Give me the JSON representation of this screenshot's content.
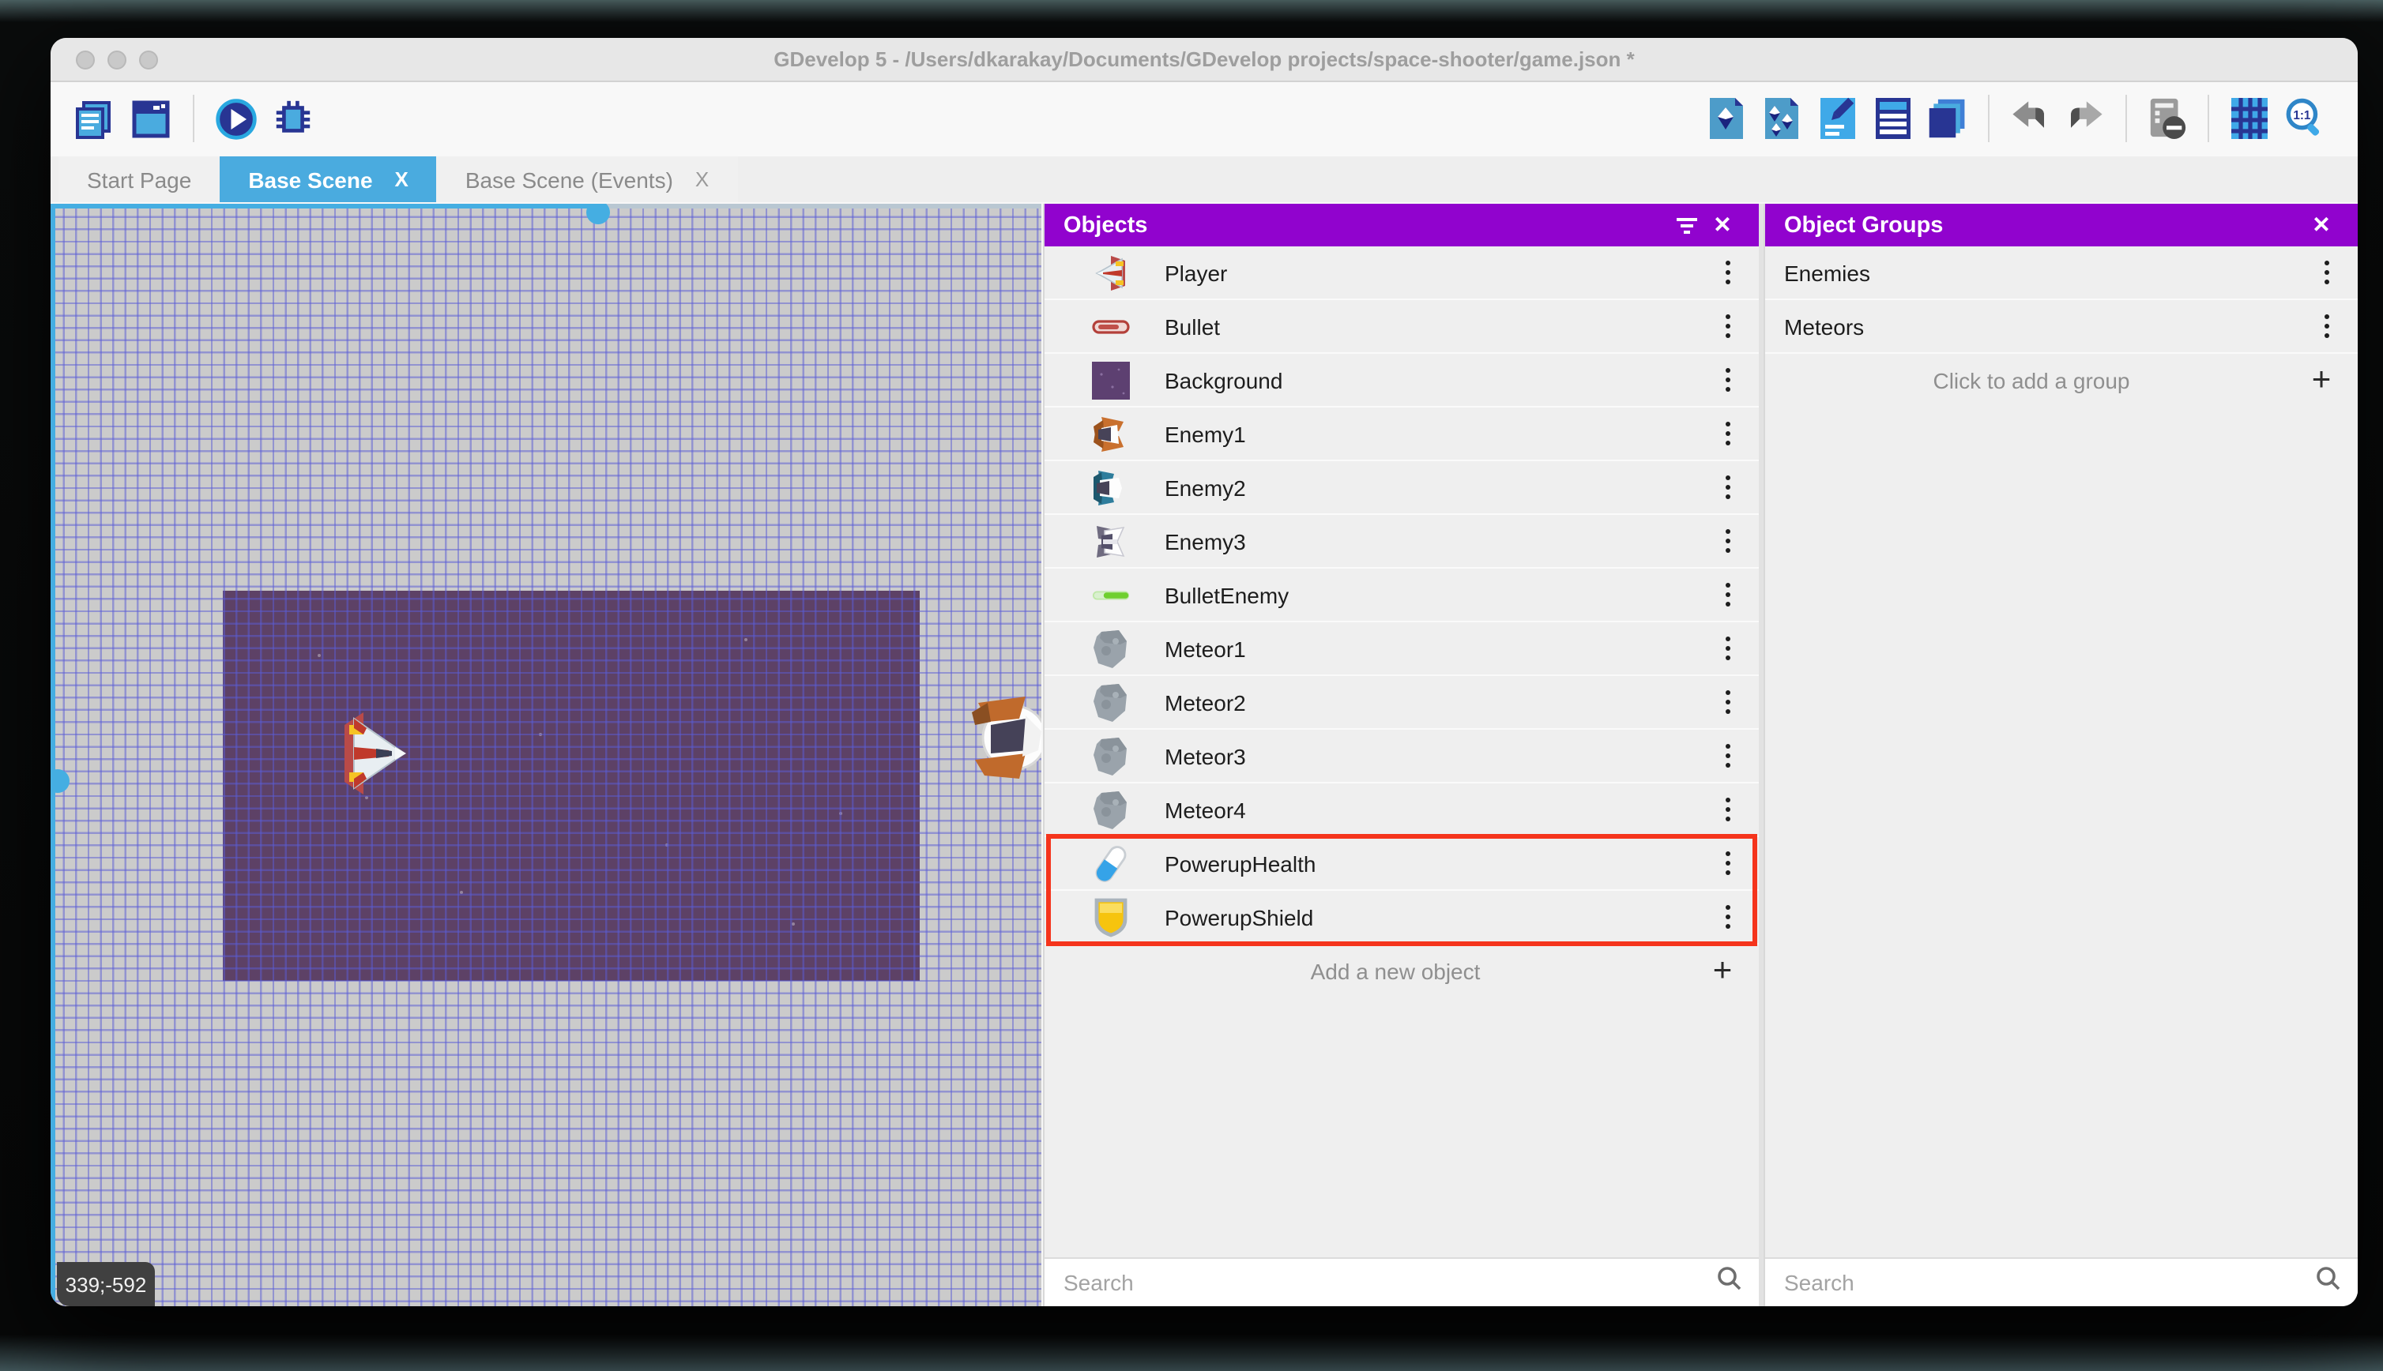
{
  "window": {
    "title": "GDevelop 5 - /Users/dkarakay/Documents/GDevelop projects/space-shooter/game.json *",
    "traffic_lights": [
      "close",
      "minimize",
      "maximize"
    ]
  },
  "toolbar": {
    "left_icons": [
      {
        "icon": "project-manager-icon"
      },
      {
        "icon": "preview-window-icon"
      },
      {
        "icon": "play-icon"
      },
      {
        "icon": "debug-icon"
      }
    ],
    "right_icons": [
      {
        "icon": "scene-objects-icon"
      },
      {
        "icon": "instances-icon"
      },
      {
        "icon": "properties-icon"
      },
      {
        "icon": "objects-list-icon"
      },
      {
        "icon": "layers-icon"
      },
      {
        "icon": "undo-icon"
      },
      {
        "icon": "redo-icon"
      },
      {
        "icon": "mask-toggle-icon"
      },
      {
        "icon": "grid-icon"
      },
      {
        "icon": "zoom-1-1-icon"
      }
    ]
  },
  "tabs": [
    {
      "label": "Start Page",
      "active": false,
      "closable": false
    },
    {
      "label": "Base Scene",
      "active": true,
      "closable": true,
      "close_glyph": "X"
    },
    {
      "label": "Base Scene (Events)",
      "active": false,
      "closable": true,
      "close_glyph": "X"
    }
  ],
  "canvas": {
    "coordinates": "339;-592"
  },
  "objects_panel": {
    "title": "Objects",
    "items": [
      {
        "label": "Player",
        "icon": "player-ship"
      },
      {
        "label": "Bullet",
        "icon": "bullet-red"
      },
      {
        "label": "Background",
        "icon": "background-purple"
      },
      {
        "label": "Enemy1",
        "icon": "enemy-orange"
      },
      {
        "label": "Enemy2",
        "icon": "enemy-teal"
      },
      {
        "label": "Enemy3",
        "icon": "enemy-gray"
      },
      {
        "label": "BulletEnemy",
        "icon": "bullet-green"
      },
      {
        "label": "Meteor1",
        "icon": "meteor"
      },
      {
        "label": "Meteor2",
        "icon": "meteor"
      },
      {
        "label": "Meteor3",
        "icon": "meteor"
      },
      {
        "label": "Meteor4",
        "icon": "meteor"
      },
      {
        "label": "PowerupHealth",
        "icon": "pill",
        "highlighted": true
      },
      {
        "label": "PowerupShield",
        "icon": "shield",
        "highlighted": true
      }
    ],
    "add_label": "Add a new object",
    "search_placeholder": "Search"
  },
  "groups_panel": {
    "title": "Object Groups",
    "items": [
      {
        "label": "Enemies"
      },
      {
        "label": "Meteors"
      }
    ],
    "add_label": "Click to add a group",
    "search_placeholder": "Search"
  },
  "colors": {
    "panel_header": "#9103ce",
    "active_tab": "#4aabdf",
    "highlight_red": "#f5341c",
    "scene_background": "#5d4166",
    "canvas_background": "#cbcbcb"
  }
}
